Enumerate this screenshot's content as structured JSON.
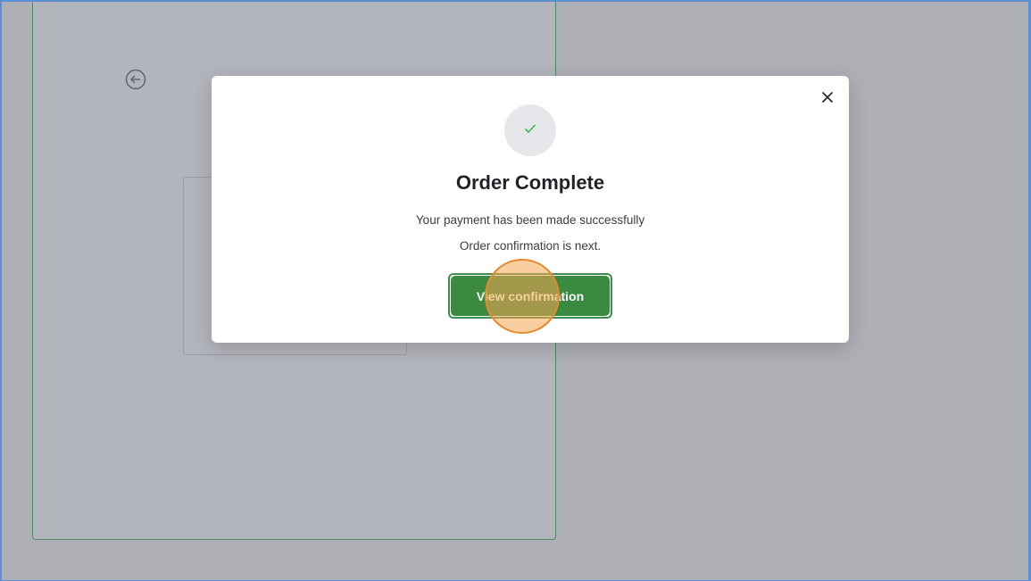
{
  "background": {
    "panel_color": "#b3b5bc",
    "panel_border_color": "#4e8a63",
    "overlay_color": "#aeb0b6",
    "back_icon": "arrow-left-circle-icon"
  },
  "modal": {
    "close_icon": "close-icon",
    "close_glyph": "✕",
    "status_icon": "check-icon",
    "status_glyph": "✓",
    "title": "Order Complete",
    "message_line1": "Your payment has been made successfully",
    "message_line2": "Order confirmation is next.",
    "primary_button_label": "View confirmation",
    "accent_color": "#3a8a42",
    "check_color": "#3db45a"
  },
  "click_marker": {
    "color": "#f5a550",
    "target": "View confirmation"
  }
}
